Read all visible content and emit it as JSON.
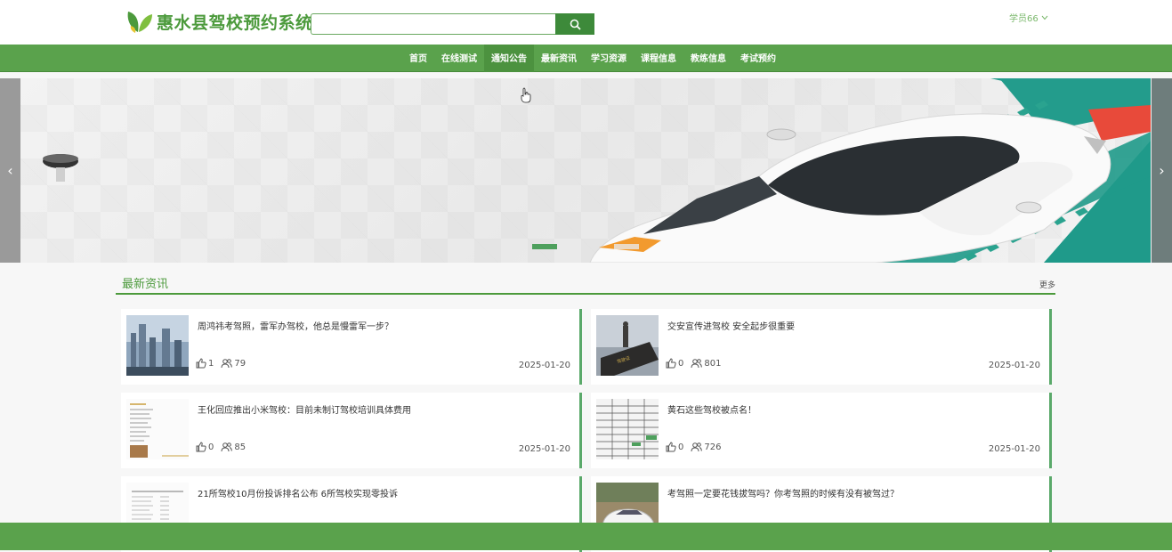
{
  "header": {
    "title": "惠水县驾校预约系统",
    "search_placeholder": "",
    "user": "学员66"
  },
  "nav": {
    "items": [
      "首页",
      "在线测试",
      "通知公告",
      "最新资讯",
      "学习资源",
      "课程信息",
      "教练信息",
      "考试预约"
    ]
  },
  "news": {
    "title": "最新资讯",
    "more": "更多",
    "items": [
      {
        "title": "周鸿祎考驾照，雷军办驾校，他总是慢雷军一步？",
        "likes": "1",
        "views": "79",
        "date": "2025-01-20"
      },
      {
        "title": "交安宣传进驾校 安全起步很重要",
        "likes": "0",
        "views": "801",
        "date": "2025-01-20"
      },
      {
        "title": "王化回应推出小米驾校：目前未制订驾校培训具体费用",
        "likes": "0",
        "views": "85",
        "date": "2025-01-20"
      },
      {
        "title": "黄石这些驾校被点名！",
        "likes": "0",
        "views": "726",
        "date": "2025-01-20"
      },
      {
        "title": "21所驾校10月份投诉排名公布 6所驾校实现零投诉",
        "likes": "",
        "views": "",
        "date": ""
      },
      {
        "title": "考驾照一定要花钱拔驾吗？你考驾照的时候有没有被驾过？",
        "likes": "",
        "views": "",
        "date": ""
      }
    ]
  },
  "colors": {
    "brand": "#5aa24c",
    "accent": "#4c9a3c",
    "card_border": "#5aa96a"
  }
}
